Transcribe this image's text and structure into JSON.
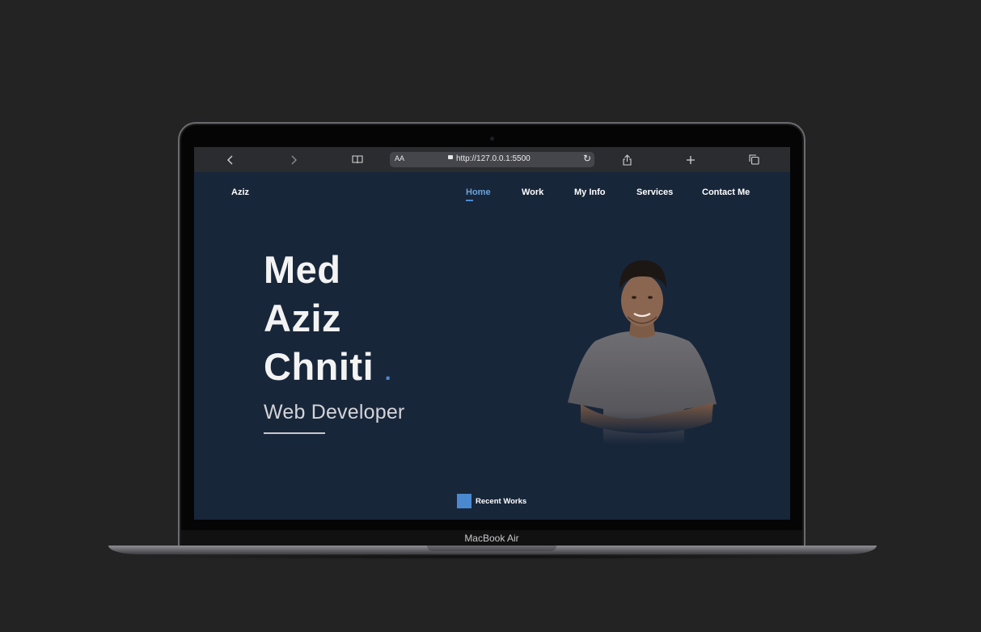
{
  "device": {
    "label": "MacBook Air"
  },
  "browser": {
    "text_size_label": "AA",
    "url": "http://127.0.0.1:5500"
  },
  "site": {
    "logo": "Aziz",
    "nav": [
      {
        "label": "Home",
        "active": true
      },
      {
        "label": "Work",
        "active": false
      },
      {
        "label": "My Info",
        "active": false
      },
      {
        "label": "Services",
        "active": false
      },
      {
        "label": "Contact Me",
        "active": false
      }
    ],
    "hero": {
      "name_lines": [
        "Med",
        "Aziz",
        "Chniti"
      ],
      "dot": ".",
      "role": "Web Developer"
    },
    "recent_works_label": "Recent Works"
  },
  "colors": {
    "page_background": "#18263a",
    "accent": "#4a8bd0",
    "active_nav": "#6aa3dc",
    "backdrop": "#232323"
  }
}
